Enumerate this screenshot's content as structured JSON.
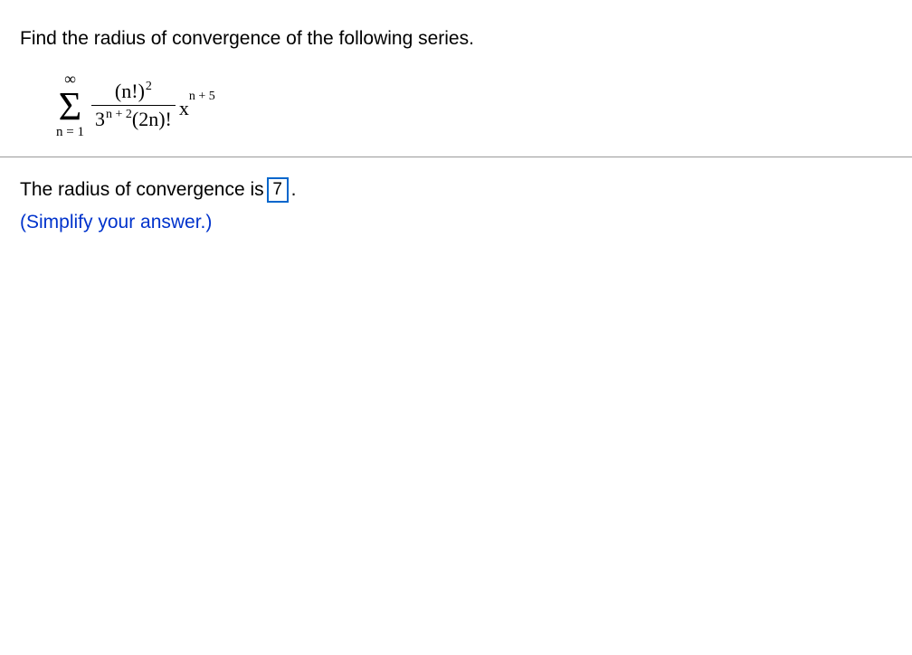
{
  "question": "Find the radius of convergence of the following series.",
  "formula": {
    "sigma_top": "∞",
    "sigma_bottom": "n = 1",
    "numerator_base": "(n!)",
    "numerator_exp": "2",
    "denom_base1": "3",
    "denom_exp1": "n + 2",
    "denom_rest": "(2n)!",
    "x_base": "x",
    "x_exp": "n + 5"
  },
  "answer": {
    "prefix": "The radius of convergence is ",
    "value": "7",
    "suffix": ".",
    "hint": "(Simplify your answer.)"
  }
}
